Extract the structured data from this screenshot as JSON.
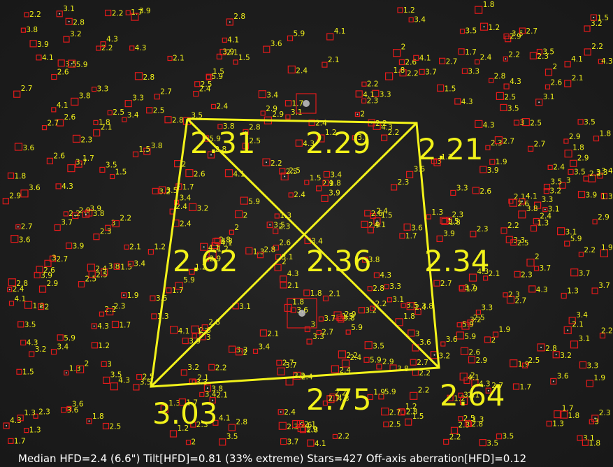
{
  "image": {
    "status_line": "Median HFD=2.4 (6.6\")  Tilt[HFD]=0.81 (33% extreme)  Stars=427  Off-axis aberration[HFD]=0.12"
  },
  "hfd_regions": {
    "top_left": "2.31",
    "top_center": "2.29",
    "top_right": "2.21",
    "middle_left": "2.62",
    "center": "2.36",
    "middle_right": "2.34",
    "bottom_left": "3.03",
    "bottom_center": "2.75",
    "bottom_right": "2.64"
  },
  "colors": {
    "star_box": "#e21b1b",
    "label": "#f2f21a",
    "overlay_line": "#f2f21a",
    "text": "#ffffff"
  },
  "star_labels": [
    "2.6",
    "2.3",
    "2.2",
    "2.7",
    "2.5",
    "2",
    "2.1",
    "1.9",
    "2.4",
    "1.7",
    "2.8",
    "1.5",
    "3.1",
    "3.4",
    "2.9",
    "4.1",
    "3.2",
    "3.3",
    "3.9",
    "3.7",
    "3",
    "1.3",
    "1.8",
    "1.2",
    "3.6",
    "4.3",
    "3.5",
    "3.8",
    "5.9"
  ]
}
